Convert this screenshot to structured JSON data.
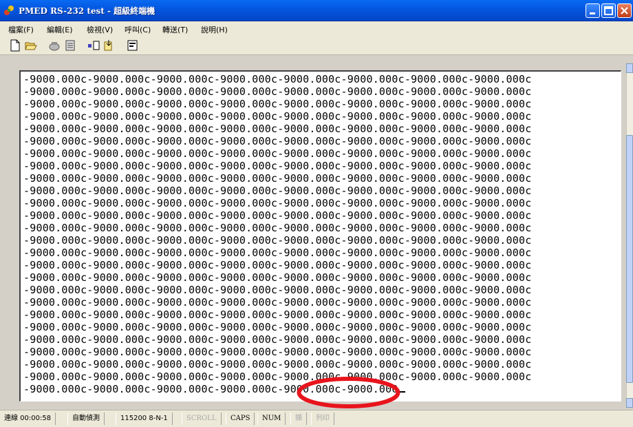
{
  "window": {
    "title": "PMED RS-232 test - 超級終端機",
    "app_icon": "hyperterminal-icon",
    "controls": [
      "minimize",
      "maximize",
      "close"
    ]
  },
  "menu": [
    "檔案(F)",
    "編輯(E)",
    "檢視(V)",
    "呼叫(C)",
    "轉送(T)",
    "說明(H)"
  ],
  "toolbar": [
    "new-icon",
    "open-icon",
    "call-icon",
    "disconnect-icon",
    "send-icon",
    "receive-icon",
    "properties-icon"
  ],
  "terminal": {
    "lines": [
      "-9000.000c-9000.000c-9000.000c-9000.000c-9000.000c-9000.000c-9000.000c-9000.000c",
      "-9000.000c-9000.000c-9000.000c-9000.000c-9000.000c-9000.000c-9000.000c-9000.000c",
      "-9000.000c-9000.000c-9000.000c-9000.000c-9000.000c-9000.000c-9000.000c-9000.000c",
      "-9000.000c-9000.000c-9000.000c-9000.000c-9000.000c-9000.000c-9000.000c-9000.000c",
      "-9000.000c-9000.000c-9000.000c-9000.000c-9000.000c-9000.000c-9000.000c-9000.000c",
      "-9000.000c-9000.000c-9000.000c-9000.000c-9000.000c-9000.000c-9000.000c-9000.000c",
      "-9000.000c-9000.000c-9000.000c-9000.000c-9000.000c-9000.000c-9000.000c-9000.000c",
      "-9000.000c-9000.000c-9000.000c-9000.000c-9000.000c-9000.000c-9000.000c-9000.000c",
      "-9000.000c-9000.000c-9000.000c-9000.000c-9000.000c-9000.000c-9000.000c-9000.000c",
      "-9000.000c-9000.000c-9000.000c-9000.000c-9000.000c-9000.000c-9000.000c-9000.000c",
      "-9000.000c-9000.000c-9000.000c-9000.000c-9000.000c-9000.000c-9000.000c-9000.000c",
      "-9000.000c-9000.000c-9000.000c-9000.000c-9000.000c-9000.000c-9000.000c-9000.000c",
      "-9000.000c-9000.000c-9000.000c-9000.000c-9000.000c-9000.000c-9000.000c-9000.000c",
      "-9000.000c-9000.000c-9000.000c-9000.000c-9000.000c-9000.000c-9000.000c-9000.000c",
      "-9000.000c-9000.000c-9000.000c-9000.000c-9000.000c-9000.000c-9000.000c-9000.000c",
      "-9000.000c-9000.000c-9000.000c-9000.000c-9000.000c-9000.000c-9000.000c-9000.000c",
      "-9000.000c-9000.000c-9000.000c-9000.000c-9000.000c-9000.000c-9000.000c-9000.000c",
      "-9000.000c-9000.000c-9000.000c-9000.000c-9000.000c-9000.000c-9000.000c-9000.000c",
      "-9000.000c-9000.000c-9000.000c-9000.000c-9000.000c-9000.000c-9000.000c-9000.000c",
      "-9000.000c-9000.000c-9000.000c-9000.000c-9000.000c-9000.000c-9000.000c-9000.000c",
      "-9000.000c-9000.000c-9000.000c-9000.000c-9000.000c-9000.000c-9000.000c-9000.000c",
      "-9000.000c-9000.000c-9000.000c-9000.000c-9000.000c-9000.000c-9000.000c-9000.000c",
      "-9000.000c-9000.000c-9000.000c-9000.000c-9000.000c-9000.000c-9000.000c-9000.000c",
      "-9000.000c-9000.000c-9000.000c-9000.000c-9000.000c-9000.000c-9000.000c-9000.000c",
      "-9000.000c-9000.000c-9000.000c-9000.000c-9000.000c-9000.000c-9000.000c-9000.000c",
      "-9000.000c-9000.000c-9000.000c-9000.000c-9000.000c-9000.000c-9000.000c-9000.000c",
      "-9000.000c-9000.000c-9000.000c-9000.000c-9000.000c-9000.000c-9000.000c-9000.000c",
      "-9000.000c-9000.000c-9000.000c-9000.000c-9000.000c-9000.000c-9000.000c-9000.000c",
      "-9000.000c-9000.000c-9000.000c-9000.000c-9000.000c-9000.000c-9000.000c-9000.000c",
      "-9000.000c-9000.000c-9000.000c-9000.000c-9000.000c-9000.000c-9000.000c-9000.000c",
      "-9000.000c-9000.000c-9000.000c-9000.000c-9000.000c-9000.000c-9000.000c-9000.000c",
      "-9000.000c-9000.000c-9000.000c-9000.000c-9000.000c-9000.000c-9000.000c-9000.000c",
      "-9000.000c-9000.000c-9000.000c-9000.000c-9000.000c-9000.000c-9000.000c-9000.000c",
      "-9000.000c-9000.000c-9000.000c-9000.000c-9000.000c-9000.000c-9000.000c-9000.000c"
    ],
    "last_line": "-9000.000c-9000.000c-9000.000c-9000.000c-9000.000c-9000.000",
    "highlight_color": "#e8141c"
  },
  "status": {
    "connection": "連線 00:00:58",
    "detect": "自動偵測",
    "port": "115200 8-N-1",
    "scroll": "SCROLL",
    "caps": "CAPS",
    "num": "NUM",
    "capture": "擷",
    "print": "列印"
  }
}
